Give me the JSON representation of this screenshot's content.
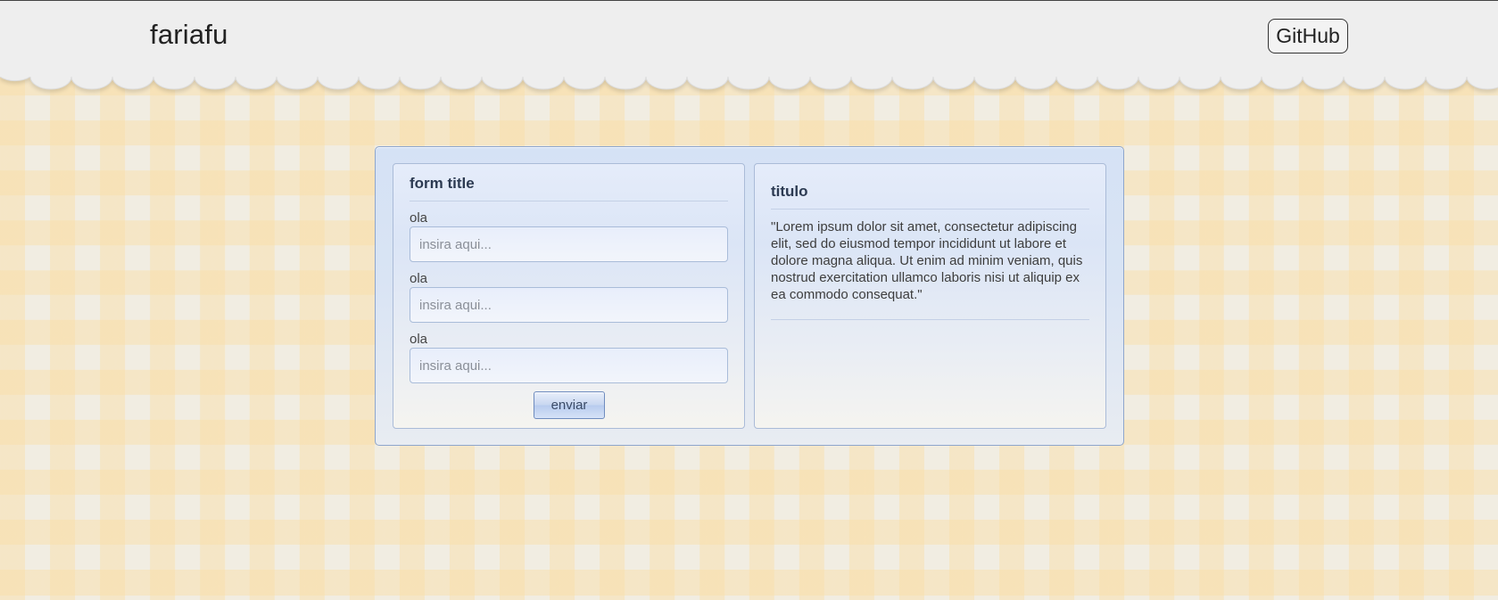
{
  "header": {
    "brand": "fariafu",
    "github_label": "GitHub"
  },
  "form": {
    "title": "form title",
    "fields": [
      {
        "label": "ola",
        "placeholder": "insira aqui..."
      },
      {
        "label": "ola",
        "placeholder": "insira aqui..."
      },
      {
        "label": "ola",
        "placeholder": "insira aqui..."
      }
    ],
    "submit_label": "enviar"
  },
  "info": {
    "title": "titulo",
    "text": "\"Lorem ipsum dolor sit amet, consectetur adipiscing elit, sed do eiusmod tempor incididunt ut labore et dolore magna aliqua. Ut enim ad minim veniam, quis nostrud exercitation ullamco laboris nisi ut aliquip ex ea commodo consequat.\""
  },
  "colors": {
    "header_bg": "#eeeeee",
    "gingham": "#fadea5",
    "window_bg": "#d5e2f5",
    "window_border": "#8ea6cc"
  }
}
